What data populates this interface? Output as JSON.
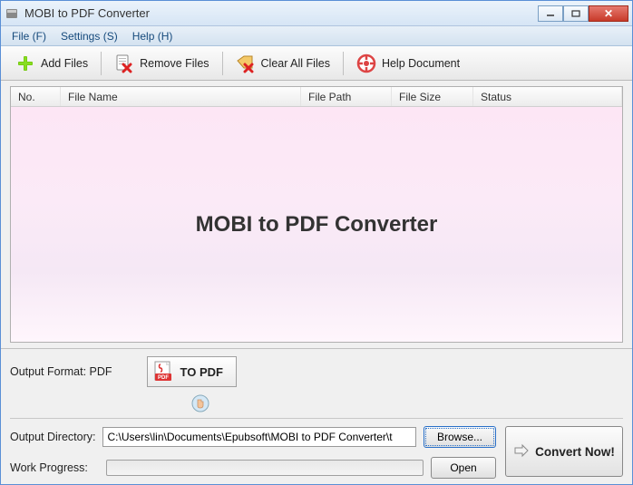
{
  "window": {
    "title": "MOBI to PDF Converter"
  },
  "menu": {
    "file": "File (F)",
    "settings": "Settings (S)",
    "help": "Help (H)"
  },
  "toolbar": {
    "add": "Add Files",
    "remove": "Remove Files",
    "clear": "Clear All Files",
    "helpdoc": "Help Document"
  },
  "list": {
    "columns": {
      "no": "No.",
      "name": "File Name",
      "path": "File Path",
      "size": "File Size",
      "status": "Status"
    },
    "watermark": "MOBI to PDF Converter"
  },
  "output": {
    "format_label": "Output Format: PDF",
    "to_pdf": "TO PDF",
    "dir_label": "Output Directory:",
    "dir_value": "C:\\Users\\lin\\Documents\\Epubsoft\\MOBI to PDF Converter\\t",
    "browse": "Browse...",
    "open": "Open",
    "progress_label": "Work Progress:",
    "convert": "Convert Now!"
  }
}
